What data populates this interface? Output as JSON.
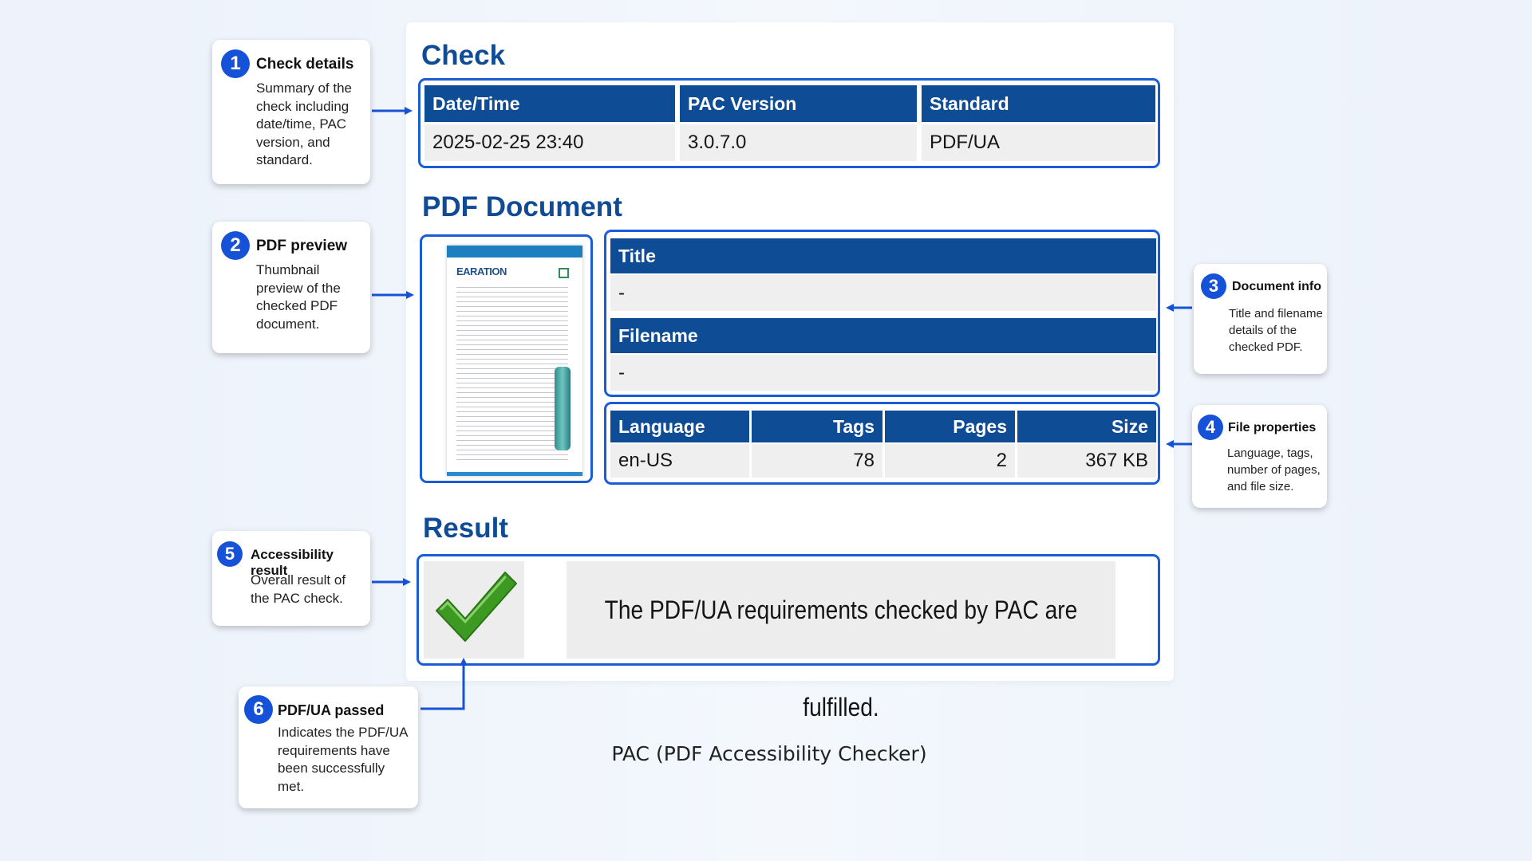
{
  "check": {
    "heading": "Check",
    "columns": [
      "Date/Time",
      "PAC Version",
      "Standard"
    ],
    "values": [
      "2025-02-25 23:40",
      "3.0.7.0",
      "PDF/UA"
    ]
  },
  "pdf_document": {
    "heading": "PDF Document",
    "title_label": "Title",
    "title_value": "-",
    "filename_label": "Filename",
    "filename_value": "-",
    "properties": {
      "columns": [
        "Language",
        "Tags",
        "Pages",
        "Size"
      ],
      "values": [
        "en-US",
        "78",
        "2",
        "367 KB"
      ]
    },
    "thumbnail": {
      "heading_text": "EARATION"
    }
  },
  "result": {
    "heading": "Result",
    "message": "The PDF/UA requirements checked by PAC are fulfilled.",
    "icon": "checkmark-icon",
    "icon_color": "#3c9a23"
  },
  "callouts": [
    {
      "number": "1",
      "title": "Check details",
      "description": "Summary of the check including date/time, PAC version, and standard."
    },
    {
      "number": "2",
      "title": "PDF preview",
      "description": "Thumbnail preview of the checked PDF document."
    },
    {
      "number": "3",
      "title": "Document info",
      "description": "Title and filename details of the checked PDF."
    },
    {
      "number": "4",
      "title": "File properties",
      "description": "Language, tags, number of pages, and file size."
    },
    {
      "number": "5",
      "title": "Accessibility result",
      "description": "Overall result of the PAC check."
    },
    {
      "number": "6",
      "title": "PDF/UA passed",
      "description": "Indicates the PDF/UA requirements have been successfully met."
    }
  ],
  "caption": "PAC (PDF Accessibility Checker)",
  "colors": {
    "header_blue": "#0e4c95",
    "accent_blue": "#1a5bd6",
    "check_green": "#3c9a23"
  }
}
